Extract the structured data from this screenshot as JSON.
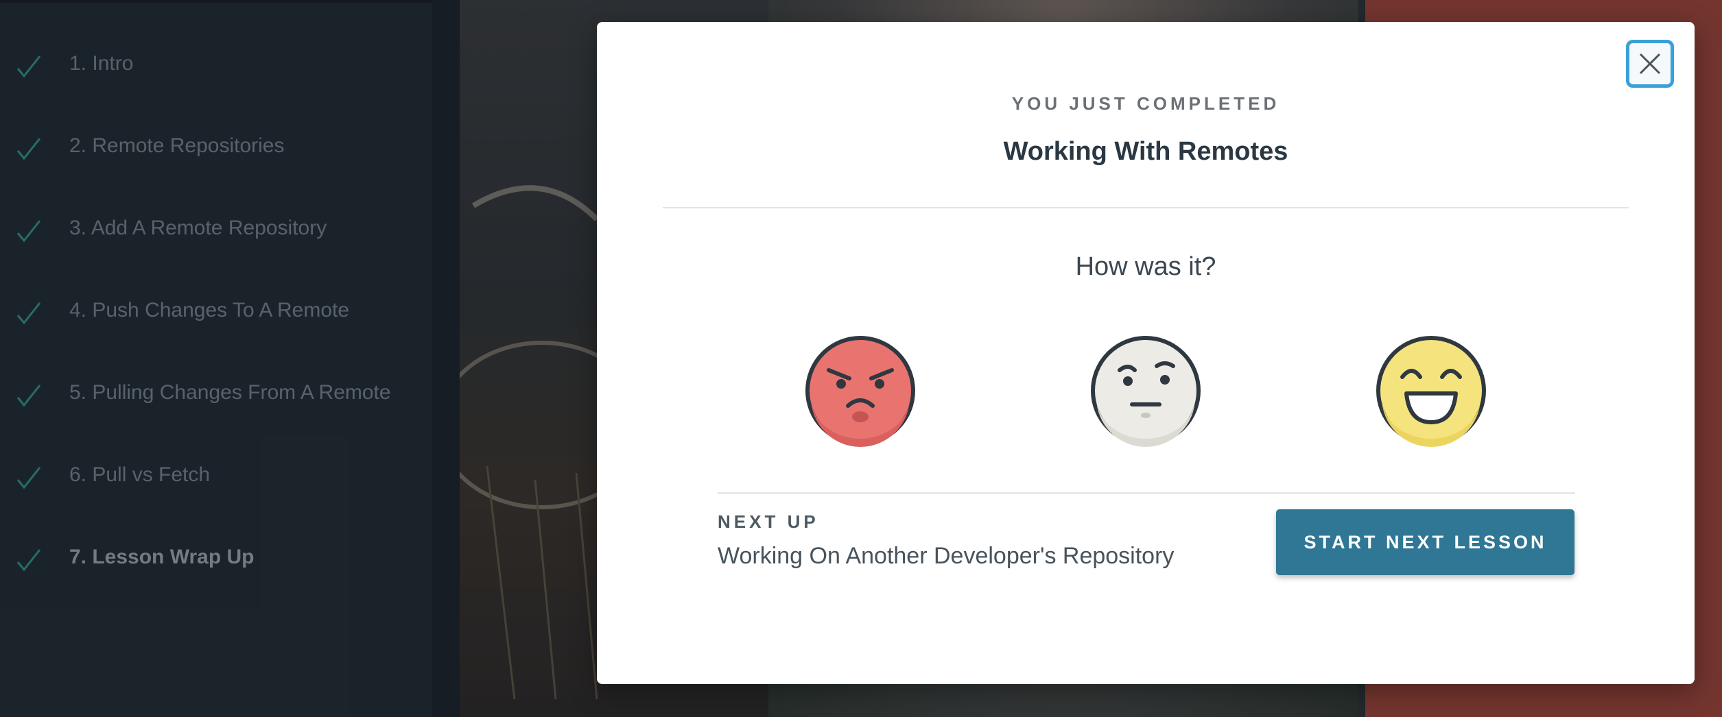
{
  "sidebar": {
    "items": [
      {
        "label": "1. Intro",
        "completed": true
      },
      {
        "label": "2. Remote Repositories",
        "completed": true
      },
      {
        "label": "3. Add A Remote Repository",
        "completed": true
      },
      {
        "label": "4. Push Changes To A Remote",
        "completed": true
      },
      {
        "label": "5. Pulling Changes From A Remote",
        "completed": true
      },
      {
        "label": "6. Pull vs Fetch",
        "completed": true
      },
      {
        "label": "7. Lesson Wrap Up",
        "completed": true,
        "current": true
      }
    ],
    "check_icon": "check-icon",
    "check_color": "#2f9e8a"
  },
  "modal": {
    "eyebrow": "YOU JUST COMPLETED",
    "completed_title": "Working With Remotes",
    "question": "How was it?",
    "ratings": [
      {
        "icon": "angry-face-icon",
        "color": "#e8736f"
      },
      {
        "icon": "neutral-face-icon",
        "color": "#ecebe5"
      },
      {
        "icon": "happy-face-icon",
        "color": "#f5e47e"
      }
    ],
    "next_up_label": "NEXT UP",
    "next_lesson_title": "Working On Another Developer's Repository",
    "start_button_label": "START NEXT LESSON",
    "close_icon": "close-icon",
    "accent_color": "#2f7795",
    "focus_color": "#3aa0d8"
  }
}
